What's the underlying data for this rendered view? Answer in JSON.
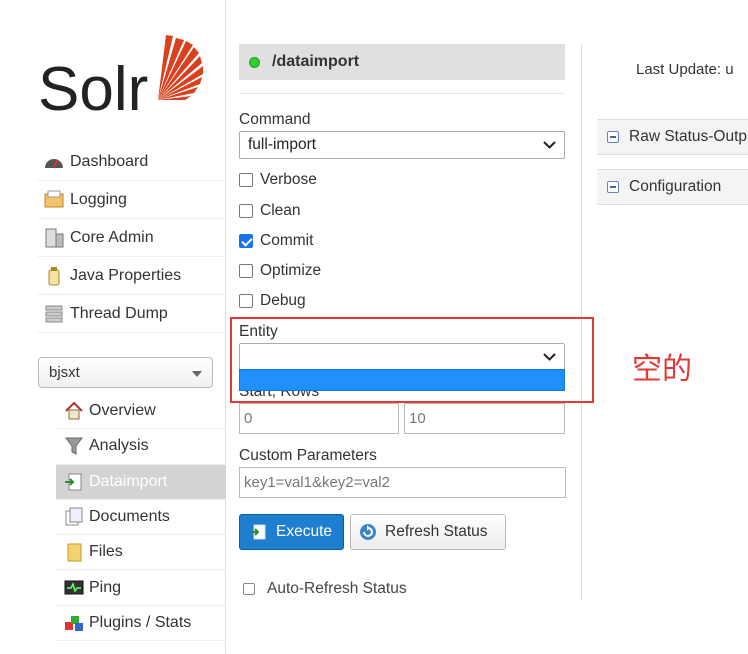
{
  "sidebar": {
    "logo_text": "Solr",
    "nav": [
      {
        "label": "Dashboard",
        "icon": "dashboard-icon"
      },
      {
        "label": "Logging",
        "icon": "logging-icon"
      },
      {
        "label": "Core Admin",
        "icon": "core-admin-icon"
      },
      {
        "label": "Java Properties",
        "icon": "java-icon"
      },
      {
        "label": "Thread Dump",
        "icon": "thread-dump-icon"
      }
    ],
    "core_selected": "bjsxt",
    "core_nav": [
      {
        "label": "Overview",
        "icon": "home-icon"
      },
      {
        "label": "Analysis",
        "icon": "funnel-icon"
      },
      {
        "label": "Dataimport",
        "icon": "dataimport-icon",
        "active": true
      },
      {
        "label": "Documents",
        "icon": "documents-icon"
      },
      {
        "label": "Files",
        "icon": "folder-icon"
      },
      {
        "label": "Ping",
        "icon": "ping-icon"
      },
      {
        "label": "Plugins / Stats",
        "icon": "plugins-icon"
      }
    ]
  },
  "panel": {
    "title": "/dataimport",
    "command_label": "Command",
    "command_value": "full-import",
    "options": [
      {
        "label": "Verbose",
        "checked": false
      },
      {
        "label": "Clean",
        "checked": false
      },
      {
        "label": "Commit",
        "checked": true
      },
      {
        "label": "Optimize",
        "checked": false
      },
      {
        "label": "Debug",
        "checked": false
      }
    ],
    "entity_label": "Entity",
    "entity_value": "",
    "start_rows_label": "Start, Rows",
    "start_placeholder": "0",
    "rows_placeholder": "10",
    "custom_params_label": "Custom Parameters",
    "custom_params_placeholder": "key1=val1&key2=val2",
    "execute_label": "Execute",
    "refresh_label": "Refresh Status",
    "auto_refresh_label": "Auto-Refresh Status"
  },
  "status": {
    "last_update_label": "Last Update: u",
    "sections": [
      "Raw Status-Output",
      "Configuration"
    ]
  },
  "annotation": {
    "note": "空的",
    "color": "#e53935"
  }
}
